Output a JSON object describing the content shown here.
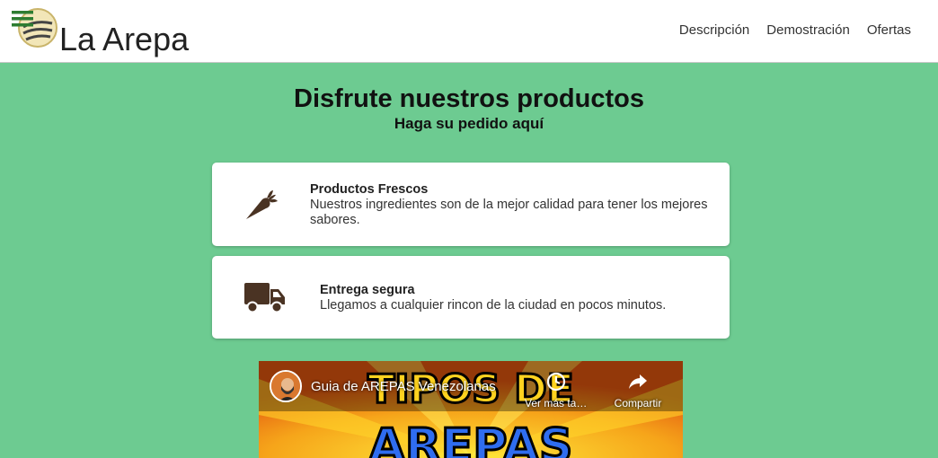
{
  "header": {
    "brand": "La Arepa",
    "nav": [
      "Descripción",
      "Demostración",
      "Ofertas"
    ]
  },
  "hero": {
    "title": "Disfrute nuestros productos",
    "subtitle": "Haga su pedido aquí"
  },
  "features": [
    {
      "icon": "carrot-icon",
      "title": "Productos Frescos",
      "description": "Nuestros ingredientes son de la mejor calidad para tener los mejores sabores."
    },
    {
      "icon": "truck-icon",
      "title": "Entrega segura",
      "description": "Llegamos a cualquier rincon de la ciudad en pocos minutos."
    }
  ],
  "video": {
    "title": "Guia de AREPAS Venezolanas",
    "watch_later": "Ver más tarde",
    "share": "Compartir",
    "thumbnail_text_top": "TIPOS DE",
    "thumbnail_text_bottom": "AREPAS"
  },
  "colors": {
    "background": "#6dcb91",
    "icon": "#4a3323",
    "hamburger": "#2e7d32"
  }
}
